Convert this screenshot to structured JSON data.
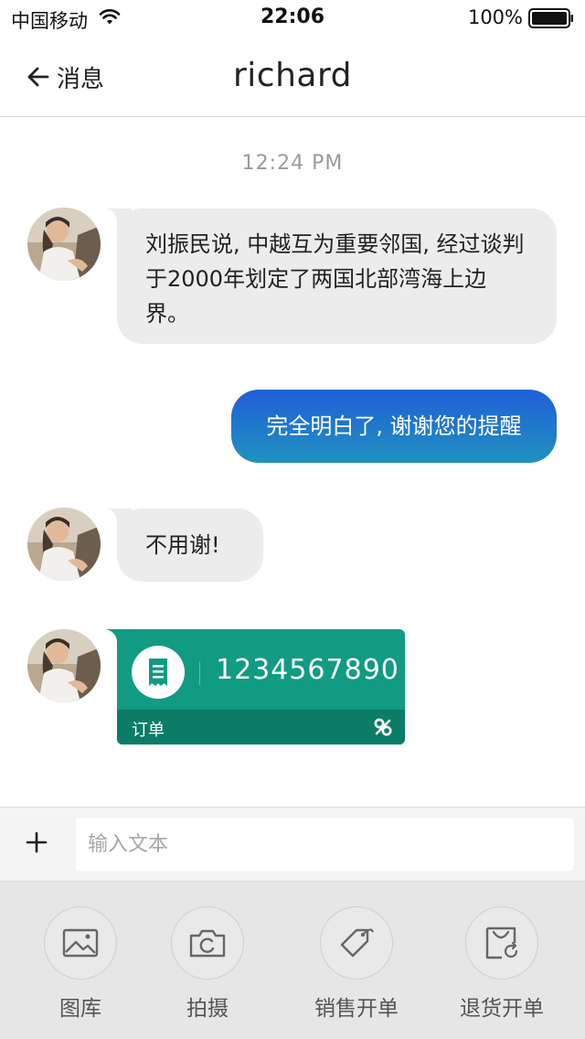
{
  "status_bar": {
    "carrier": "中国移动",
    "time": "22:06",
    "battery": "100%"
  },
  "nav": {
    "back_label": "消息",
    "title": "richard"
  },
  "chat": {
    "timestamp": "12:24 PM",
    "messages": [
      {
        "sender": "other",
        "text": "刘振民说, 中越互为重要邻国, 经过谈判于2000年划定了两国北部湾海上边界。"
      },
      {
        "sender": "me",
        "text": "完全明白了, 谢谢您的提醒"
      },
      {
        "sender": "other",
        "text": "不用谢!"
      }
    ],
    "order_card": {
      "number": "1234567890",
      "label": "订单",
      "icon": "receipt-icon",
      "brand_icon": "brand-logo-icon"
    }
  },
  "input": {
    "placeholder": "输入文本",
    "value": ""
  },
  "actions": [
    {
      "label": "图库",
      "icon": "image-icon"
    },
    {
      "label": "拍摄",
      "icon": "camera-icon"
    },
    {
      "label": "销售开单",
      "icon": "tag-icon"
    },
    {
      "label": "退货开单",
      "icon": "return-bag-icon"
    }
  ],
  "colors": {
    "outgoing_bubble_top": "#1f5fd8",
    "outgoing_bubble_bottom": "#2091bf",
    "incoming_bubble": "#ececec",
    "order_card": "#109b82",
    "order_card_footer": "#0b7c66"
  }
}
